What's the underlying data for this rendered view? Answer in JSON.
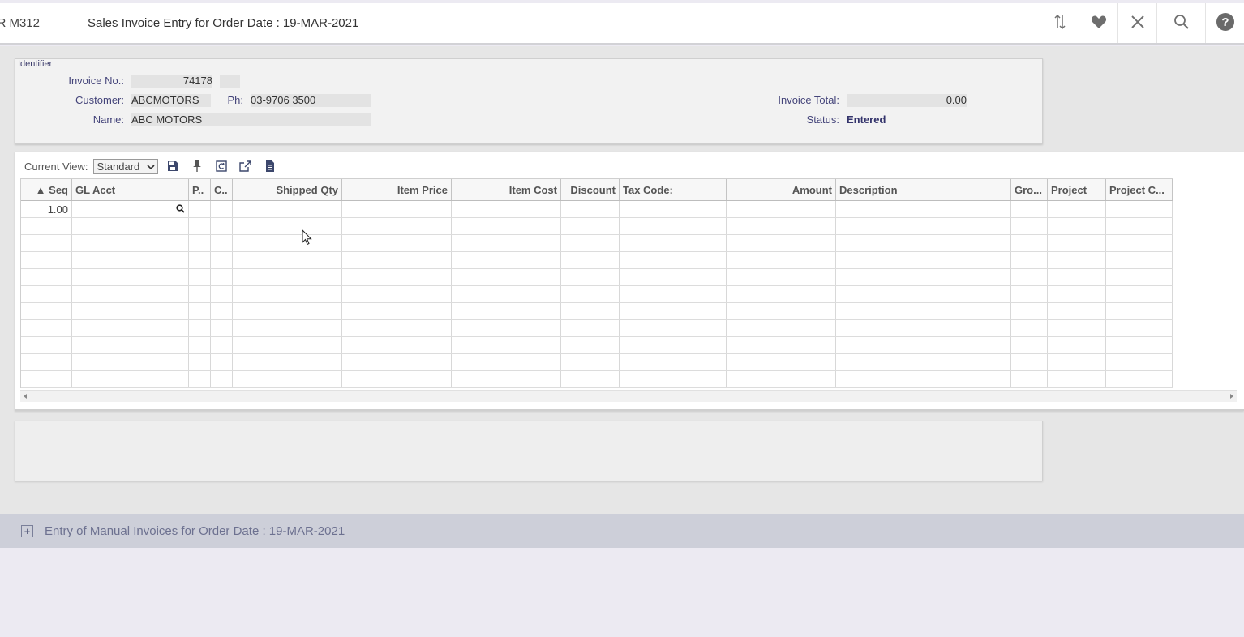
{
  "header": {
    "program_code": "R M312",
    "title": "Sales Invoice Entry for Order Date : 19-MAR-2021",
    "icons": [
      "sort-toggle-icon",
      "favorite-heart-icon",
      "close-icon",
      "search-icon",
      "help-icon"
    ]
  },
  "identifier": {
    "legend": "Identifier",
    "invoice_no_label": "Invoice No.:",
    "invoice_no": "74178",
    "invoice_suffix": "",
    "customer_label": "Customer:",
    "customer": "ABCMOTORS",
    "phone_label": "Ph:",
    "phone": "03-9706 3500",
    "name_label": "Name:",
    "name": "ABC MOTORS",
    "invoice_total_label": "Invoice Total:",
    "invoice_total": "0.00",
    "status_label": "Status:",
    "status": "Entered"
  },
  "grid": {
    "view_label": "Current View:",
    "view_value": "Standard",
    "toolbar_icons": [
      "save-icon",
      "pin-icon",
      "restore-icon",
      "export-icon",
      "document-icon"
    ],
    "columns": [
      {
        "label": "▲ Seq",
        "align": "r"
      },
      {
        "label": "GL Acct",
        "align": "l"
      },
      {
        "label": "P..",
        "align": "l"
      },
      {
        "label": "C..",
        "align": "l"
      },
      {
        "label": "Shipped Qty",
        "align": "r"
      },
      {
        "label": "Item Price",
        "align": "r"
      },
      {
        "label": "Item Cost",
        "align": "r"
      },
      {
        "label": "Discount",
        "align": "r"
      },
      {
        "label": "Tax Code:",
        "align": "l"
      },
      {
        "label": "Amount",
        "align": "r"
      },
      {
        "label": "Description",
        "align": "l"
      },
      {
        "label": "Gro...",
        "align": "l"
      },
      {
        "label": "Project",
        "align": "l"
      },
      {
        "label": "Project C...",
        "align": "l"
      }
    ],
    "rows": [
      [
        "1.00",
        "",
        "",
        "",
        "",
        "",
        "",
        "",
        "",
        "",
        "",
        "",
        "",
        ""
      ],
      [
        "",
        "",
        "",
        "",
        "",
        "",
        "",
        "",
        "",
        "",
        "",
        "",
        "",
        ""
      ],
      [
        "",
        "",
        "",
        "",
        "",
        "",
        "",
        "",
        "",
        "",
        "",
        "",
        "",
        ""
      ],
      [
        "",
        "",
        "",
        "",
        "",
        "",
        "",
        "",
        "",
        "",
        "",
        "",
        "",
        ""
      ],
      [
        "",
        "",
        "",
        "",
        "",
        "",
        "",
        "",
        "",
        "",
        "",
        "",
        "",
        ""
      ],
      [
        "",
        "",
        "",
        "",
        "",
        "",
        "",
        "",
        "",
        "",
        "",
        "",
        "",
        ""
      ],
      [
        "",
        "",
        "",
        "",
        "",
        "",
        "",
        "",
        "",
        "",
        "",
        "",
        "",
        ""
      ],
      [
        "",
        "",
        "",
        "",
        "",
        "",
        "",
        "",
        "",
        "",
        "",
        "",
        "",
        ""
      ],
      [
        "",
        "",
        "",
        "",
        "",
        "",
        "",
        "",
        "",
        "",
        "",
        "",
        "",
        ""
      ],
      [
        "",
        "",
        "",
        "",
        "",
        "",
        "",
        "",
        "",
        "",
        "",
        "",
        "",
        ""
      ],
      [
        "",
        "",
        "",
        "",
        "",
        "",
        "",
        "",
        "",
        "",
        "",
        "",
        "",
        ""
      ]
    ]
  },
  "section": {
    "title": "Entry of Manual Invoices for Order Date : 19-MAR-2021"
  }
}
